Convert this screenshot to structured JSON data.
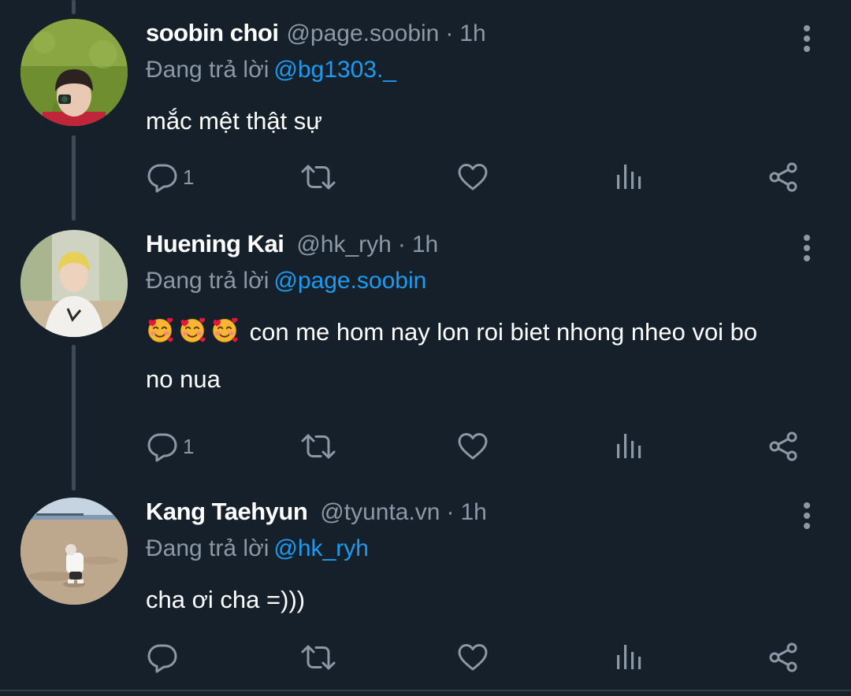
{
  "theme": {
    "background": "#15202b",
    "text": "#ffffff",
    "secondary": "#8b98a5",
    "accent": "#1d9bf0",
    "thread_line": "#3d4a57"
  },
  "reply_prefix": "Đang trả lời",
  "tweets": [
    {
      "name": "soobin choi",
      "handle": "@page.soobin",
      "separator": "·",
      "time": "1h",
      "reply_to": "@bg1303._",
      "text": "mắc mệt thật sự",
      "reply_count": "1",
      "avatar": "avatar-soobin"
    },
    {
      "name": "Huening Kai",
      "handle": "@hk_ryh",
      "separator": "·",
      "time": "1h",
      "reply_to": "@page.soobin",
      "emojis": [
        "smiling-face-with-hearts-emoji",
        "smiling-face-with-hearts-emoji",
        "smiling-face-with-hearts-emoji"
      ],
      "text_line1": "con me hom nay lon roi biet nhong nheo voi bo",
      "text_line2": "no nua",
      "reply_count": "1",
      "avatar": "avatar-hueningkai"
    },
    {
      "name": "Kang Taehyun",
      "handle": "@tyunta.vn",
      "separator": "·",
      "time": "1h",
      "reply_to": "@hk_ryh",
      "text": "cha ơi cha =)))",
      "reply_count": "",
      "avatar": "avatar-taehyun"
    }
  ],
  "icons": {
    "reply": "speech-bubble-icon",
    "retweet": "retweet-icon",
    "like": "heart-icon",
    "views": "bar-chart-icon",
    "share": "share-icon",
    "more": "vertical-ellipsis-icon"
  }
}
